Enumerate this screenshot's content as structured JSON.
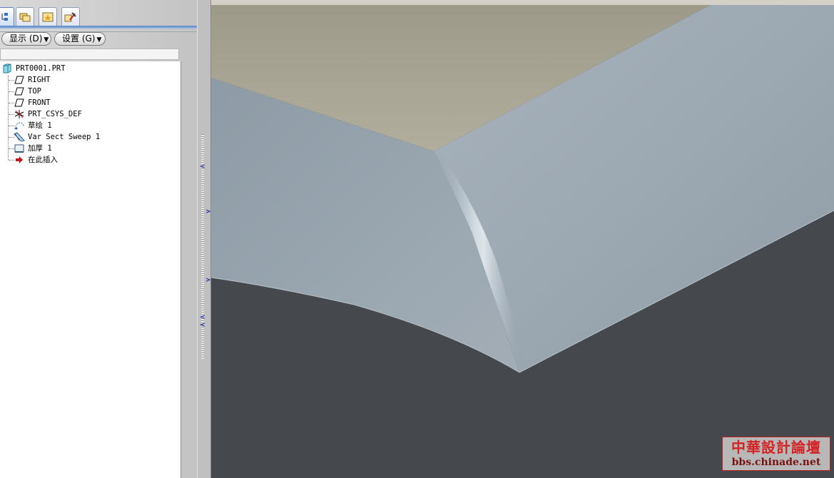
{
  "panel": {
    "display_menu_label": "显示 (D)",
    "settings_menu_label": "设置 (G)"
  },
  "tree": {
    "items": [
      {
        "label": "PRT0001.PRT",
        "icon": "part-icon"
      },
      {
        "label": "RIGHT",
        "icon": "datum-plane-icon"
      },
      {
        "label": "TOP",
        "icon": "datum-plane-icon"
      },
      {
        "label": "FRONT",
        "icon": "datum-plane-icon"
      },
      {
        "label": "PRT_CSYS_DEF",
        "icon": "coordinate-system-icon"
      },
      {
        "label": "草绘 1",
        "icon": "sketch-icon"
      },
      {
        "label": "Var Sect Sweep 1",
        "icon": "variable-section-sweep-icon"
      },
      {
        "label": "加厚 1",
        "icon": "thicken-icon"
      },
      {
        "label": "在此插入",
        "icon": "insert-here-arrow-icon"
      }
    ]
  },
  "watermark": {
    "title": "中華設計論壇",
    "url": "bbs.chinade.net"
  },
  "colors": {
    "viewport_dark": "#45484c",
    "viewport_tan": "#a6a393",
    "surface": "#9ba7b1",
    "accent": "#5a86c4",
    "watermark_red": "#d42222"
  }
}
